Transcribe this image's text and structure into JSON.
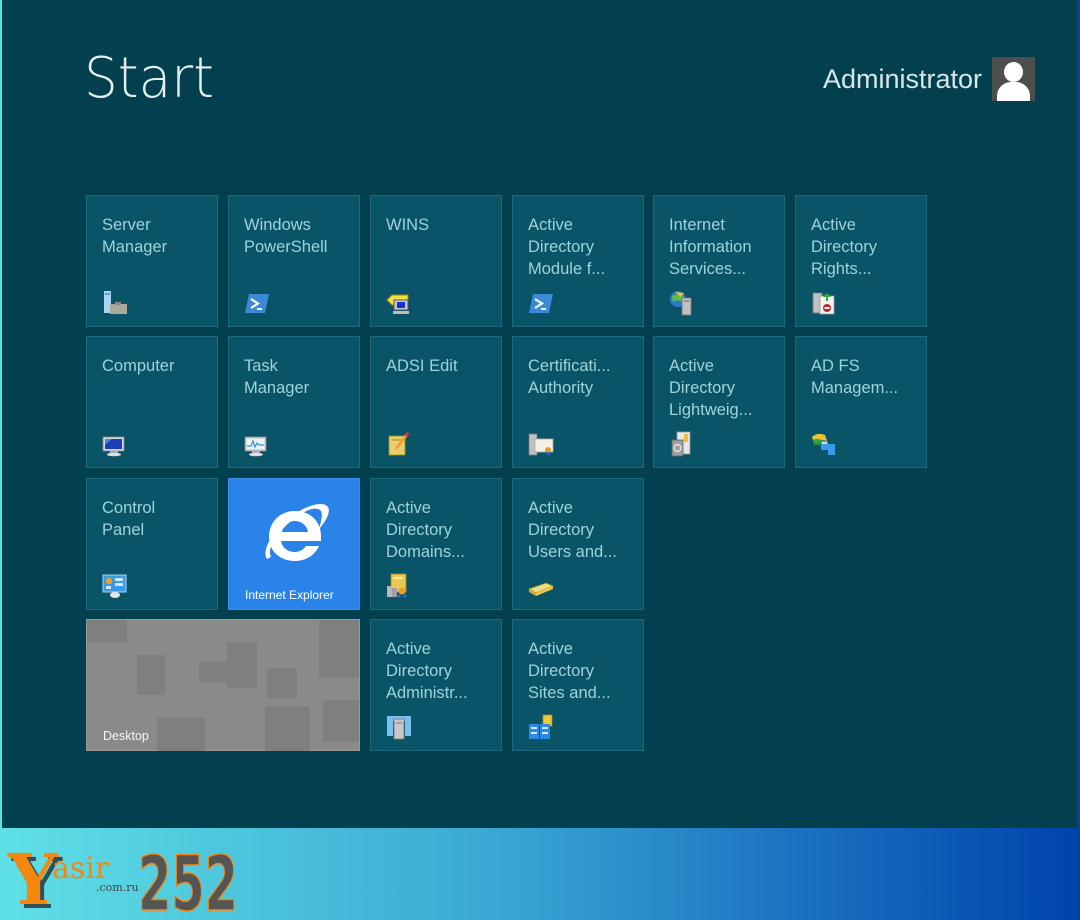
{
  "header": {
    "title": "Start",
    "user_name": "Administrator"
  },
  "tiles": [
    {
      "label": "Server\nManager",
      "icon": "server-manager-icon"
    },
    {
      "label": "Windows\nPowerShell",
      "icon": "powershell-icon"
    },
    {
      "label": "WINS",
      "icon": "wins-icon"
    },
    {
      "label": "Active\nDirectory\nModule f...",
      "icon": "powershell-icon"
    },
    {
      "label": "Internet\nInformation\nServices...",
      "icon": "iis-icon"
    },
    {
      "label": "Active\nDirectory\nRights...",
      "icon": "rights-management-icon"
    },
    {
      "label": "Computer",
      "icon": "computer-icon"
    },
    {
      "label": "Task\nManager",
      "icon": "task-manager-icon"
    },
    {
      "label": "ADSI Edit",
      "icon": "adsi-edit-icon"
    },
    {
      "label": "Certificati...\nAuthority",
      "icon": "certificate-authority-icon"
    },
    {
      "label": "Active\nDirectory\nLightweig...",
      "icon": "lightweight-directory-icon"
    },
    {
      "label": "AD FS\nManagem...",
      "icon": "adfs-management-icon"
    },
    {
      "label": "Control\nPanel",
      "icon": "control-panel-icon"
    },
    {
      "label": "Internet Explorer",
      "icon": "internet-explorer-icon"
    },
    {
      "label": "Active\nDirectory\nDomains...",
      "icon": "domains-trusts-icon"
    },
    {
      "label": "Active\nDirectory\nUsers and...",
      "icon": "users-computers-icon"
    },
    {
      "label": "Desktop",
      "icon": "desktop-icon"
    },
    {
      "label": "Active\nDirectory\nAdministr...",
      "icon": "admin-center-icon"
    },
    {
      "label": "Active\nDirectory\nSites and...",
      "icon": "sites-services-icon"
    }
  ],
  "watermark": {
    "letter": "Y",
    "word": "asir",
    "domain": ".com.ru",
    "number": "252"
  },
  "colors": {
    "start_background": "#02404f",
    "tile_background": "#0a5468",
    "ie_tile": "#2a83e8",
    "desktop_tile": "#8a8a8a",
    "brand_orange": "#f5870f",
    "brand_gray": "#555555"
  }
}
